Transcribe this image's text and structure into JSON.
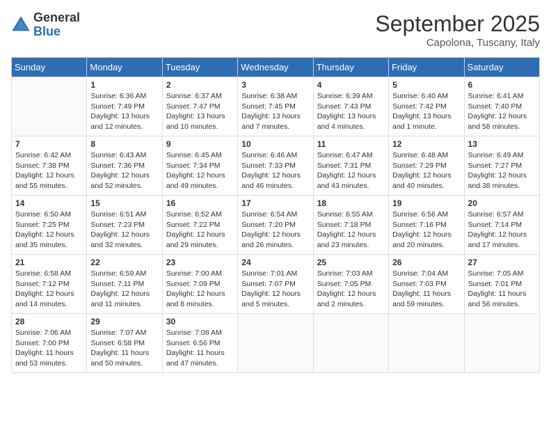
{
  "logo": {
    "general": "General",
    "blue": "Blue"
  },
  "title": "September 2025",
  "subtitle": "Capolona, Tuscany, Italy",
  "days_of_week": [
    "Sunday",
    "Monday",
    "Tuesday",
    "Wednesday",
    "Thursday",
    "Friday",
    "Saturday"
  ],
  "weeks": [
    [
      {
        "day": "",
        "content": ""
      },
      {
        "day": "1",
        "content": "Sunrise: 6:36 AM\nSunset: 7:49 PM\nDaylight: 13 hours\nand 12 minutes."
      },
      {
        "day": "2",
        "content": "Sunrise: 6:37 AM\nSunset: 7:47 PM\nDaylight: 13 hours\nand 10 minutes."
      },
      {
        "day": "3",
        "content": "Sunrise: 6:38 AM\nSunset: 7:45 PM\nDaylight: 13 hours\nand 7 minutes."
      },
      {
        "day": "4",
        "content": "Sunrise: 6:39 AM\nSunset: 7:43 PM\nDaylight: 13 hours\nand 4 minutes."
      },
      {
        "day": "5",
        "content": "Sunrise: 6:40 AM\nSunset: 7:42 PM\nDaylight: 13 hours\nand 1 minute."
      },
      {
        "day": "6",
        "content": "Sunrise: 6:41 AM\nSunset: 7:40 PM\nDaylight: 12 hours\nand 58 minutes."
      }
    ],
    [
      {
        "day": "7",
        "content": "Sunrise: 6:42 AM\nSunset: 7:38 PM\nDaylight: 12 hours\nand 55 minutes."
      },
      {
        "day": "8",
        "content": "Sunrise: 6:43 AM\nSunset: 7:36 PM\nDaylight: 12 hours\nand 52 minutes."
      },
      {
        "day": "9",
        "content": "Sunrise: 6:45 AM\nSunset: 7:34 PM\nDaylight: 12 hours\nand 49 minutes."
      },
      {
        "day": "10",
        "content": "Sunrise: 6:46 AM\nSunset: 7:33 PM\nDaylight: 12 hours\nand 46 minutes."
      },
      {
        "day": "11",
        "content": "Sunrise: 6:47 AM\nSunset: 7:31 PM\nDaylight: 12 hours\nand 43 minutes."
      },
      {
        "day": "12",
        "content": "Sunrise: 6:48 AM\nSunset: 7:29 PM\nDaylight: 12 hours\nand 40 minutes."
      },
      {
        "day": "13",
        "content": "Sunrise: 6:49 AM\nSunset: 7:27 PM\nDaylight: 12 hours\nand 38 minutes."
      }
    ],
    [
      {
        "day": "14",
        "content": "Sunrise: 6:50 AM\nSunset: 7:25 PM\nDaylight: 12 hours\nand 35 minutes."
      },
      {
        "day": "15",
        "content": "Sunrise: 6:51 AM\nSunset: 7:23 PM\nDaylight: 12 hours\nand 32 minutes."
      },
      {
        "day": "16",
        "content": "Sunrise: 6:52 AM\nSunset: 7:22 PM\nDaylight: 12 hours\nand 29 minutes."
      },
      {
        "day": "17",
        "content": "Sunrise: 6:54 AM\nSunset: 7:20 PM\nDaylight: 12 hours\nand 26 minutes."
      },
      {
        "day": "18",
        "content": "Sunrise: 6:55 AM\nSunset: 7:18 PM\nDaylight: 12 hours\nand 23 minutes."
      },
      {
        "day": "19",
        "content": "Sunrise: 6:56 AM\nSunset: 7:16 PM\nDaylight: 12 hours\nand 20 minutes."
      },
      {
        "day": "20",
        "content": "Sunrise: 6:57 AM\nSunset: 7:14 PM\nDaylight: 12 hours\nand 17 minutes."
      }
    ],
    [
      {
        "day": "21",
        "content": "Sunrise: 6:58 AM\nSunset: 7:12 PM\nDaylight: 12 hours\nand 14 minutes."
      },
      {
        "day": "22",
        "content": "Sunrise: 6:59 AM\nSunset: 7:11 PM\nDaylight: 12 hours\nand 11 minutes."
      },
      {
        "day": "23",
        "content": "Sunrise: 7:00 AM\nSunset: 7:09 PM\nDaylight: 12 hours\nand 8 minutes."
      },
      {
        "day": "24",
        "content": "Sunrise: 7:01 AM\nSunset: 7:07 PM\nDaylight: 12 hours\nand 5 minutes."
      },
      {
        "day": "25",
        "content": "Sunrise: 7:03 AM\nSunset: 7:05 PM\nDaylight: 12 hours\nand 2 minutes."
      },
      {
        "day": "26",
        "content": "Sunrise: 7:04 AM\nSunset: 7:03 PM\nDaylight: 11 hours\nand 59 minutes."
      },
      {
        "day": "27",
        "content": "Sunrise: 7:05 AM\nSunset: 7:01 PM\nDaylight: 11 hours\nand 56 minutes."
      }
    ],
    [
      {
        "day": "28",
        "content": "Sunrise: 7:06 AM\nSunset: 7:00 PM\nDaylight: 11 hours\nand 53 minutes."
      },
      {
        "day": "29",
        "content": "Sunrise: 7:07 AM\nSunset: 6:58 PM\nDaylight: 11 hours\nand 50 minutes."
      },
      {
        "day": "30",
        "content": "Sunrise: 7:08 AM\nSunset: 6:56 PM\nDaylight: 11 hours\nand 47 minutes."
      },
      {
        "day": "",
        "content": ""
      },
      {
        "day": "",
        "content": ""
      },
      {
        "day": "",
        "content": ""
      },
      {
        "day": "",
        "content": ""
      }
    ]
  ]
}
